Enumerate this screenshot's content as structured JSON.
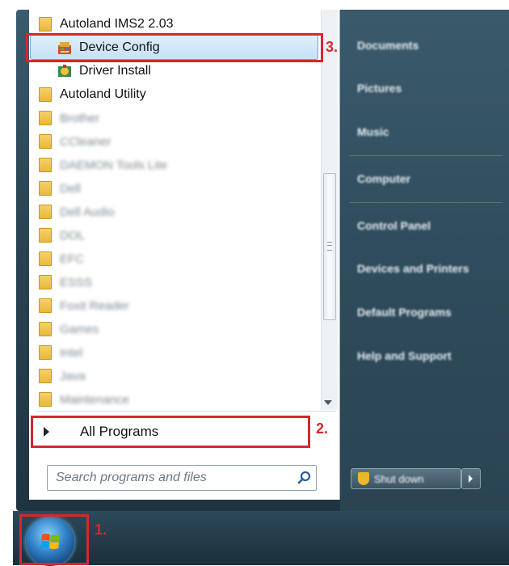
{
  "program_list": {
    "folder_autoland_ims2": "Autoland IMS2 2.03",
    "item_device_config": "Device Config",
    "item_driver_install": "Driver Install",
    "folder_autoland_utility": "Autoland Utility",
    "blurred_folders": [
      "Brother",
      "CCleaner",
      "DAEMON Tools Lite",
      "Dell",
      "Dell Audio",
      "DOL",
      "EFC",
      "ESSS",
      "Foxit Reader",
      "Games",
      "Intel",
      "Java",
      "Maintenance"
    ]
  },
  "all_programs_label": "All Programs",
  "search": {
    "placeholder": "Search programs and files"
  },
  "right_pane": {
    "items": [
      "Documents",
      "Pictures",
      "Music",
      "Computer",
      "Control Panel",
      "Devices and Printers",
      "Default Programs",
      "Help and Support"
    ],
    "shutdown_label": "Shut down"
  },
  "callouts": {
    "step1": "1.",
    "step2": "2.",
    "step3": "3."
  },
  "colors": {
    "callout": "#d4282f",
    "selection": "#c6e1f6"
  },
  "icons": [
    "folder-icon",
    "device-config-icon",
    "driver-install-icon",
    "search-icon",
    "windows-start-orb-icon",
    "shield-icon",
    "arrow-right-icon"
  ]
}
